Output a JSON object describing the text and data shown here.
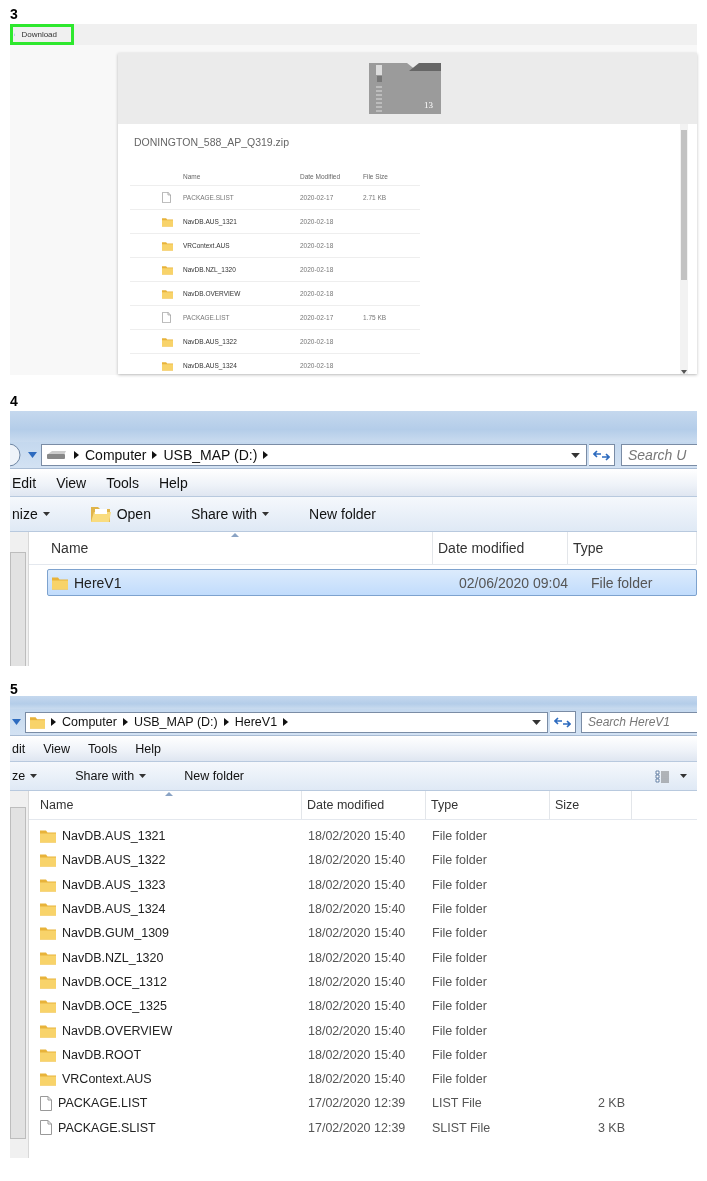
{
  "panels": [
    {
      "kind": "web",
      "number": "3",
      "download": {
        "label": "Download",
        "highlighted": true
      },
      "archive": {
        "name": "DONINGTON_588_AP_Q319.zip",
        "count": "13",
        "columns": [
          "Name",
          "Date Modified",
          "File Size"
        ],
        "rows": [
          {
            "kind": "file",
            "name": "PACKAGE.SLIST",
            "date": "2020-02-17",
            "size": "2.71 KB"
          },
          {
            "kind": "folder",
            "name": "NavDB.AUS_1321",
            "date": "2020-02-18"
          },
          {
            "kind": "folder",
            "name": "VRContext.AUS",
            "date": "2020-02-18"
          },
          {
            "kind": "folder",
            "name": "NavDB.NZL_1320",
            "date": "2020-02-18"
          },
          {
            "kind": "folder",
            "name": "NavDB.OVERVIEW",
            "date": "2020-02-18"
          },
          {
            "kind": "file",
            "name": "PACKAGE.LIST",
            "date": "2020-02-17",
            "size": "1.75 KB"
          },
          {
            "kind": "folder",
            "name": "NavDB.AUS_1322",
            "date": "2020-02-18"
          },
          {
            "kind": "folder",
            "name": "NavDB.AUS_1324",
            "date": "2020-02-18"
          }
        ]
      }
    },
    {
      "kind": "explorer",
      "number": "4",
      "back_button": true,
      "in_folder": false,
      "path": [
        "Computer",
        "USB_MAP (D:)"
      ],
      "search": {
        "placeholder": "Search U"
      },
      "menu": [
        "Edit",
        "View",
        "Tools",
        "Help"
      ],
      "toolbar": [
        {
          "kind": "text",
          "label": "nize",
          "dropdown": true
        },
        {
          "kind": "with_icon",
          "label": "Open",
          "dropdown": false
        },
        {
          "kind": "text",
          "label": "Share with",
          "dropdown": true
        },
        {
          "kind": "text",
          "label": "New folder",
          "dropdown": false
        }
      ],
      "view_button": false,
      "columns": [
        "Name",
        "Date modified",
        "Type"
      ],
      "rows": [
        {
          "kind": "folder",
          "name": "HereV1",
          "date": "02/06/2020 09:04",
          "type": "File folder",
          "selected": true
        }
      ]
    },
    {
      "kind": "explorer",
      "number": "5",
      "back_button": false,
      "in_folder": true,
      "path": [
        "Computer",
        "USB_MAP (D:)",
        "HereV1"
      ],
      "search": {
        "placeholder": "Search HereV1"
      },
      "menu": [
        "dit",
        "View",
        "Tools",
        "Help"
      ],
      "toolbar": [
        {
          "kind": "text",
          "label": "ze",
          "dropdown": true
        },
        {
          "kind": "text",
          "label": "Share with",
          "dropdown": true
        },
        {
          "kind": "text",
          "label": "New folder",
          "dropdown": false
        }
      ],
      "view_button": true,
      "columns": [
        "Name",
        "Date modified",
        "Type",
        "Size"
      ],
      "rows": [
        {
          "kind": "folder",
          "name": "NavDB.AUS_1321",
          "date": "18/02/2020 15:40",
          "type": "File folder",
          "selected": false
        },
        {
          "kind": "folder",
          "name": "NavDB.AUS_1322",
          "date": "18/02/2020 15:40",
          "type": "File folder",
          "selected": false
        },
        {
          "kind": "folder",
          "name": "NavDB.AUS_1323",
          "date": "18/02/2020 15:40",
          "type": "File folder",
          "selected": false
        },
        {
          "kind": "folder",
          "name": "NavDB.AUS_1324",
          "date": "18/02/2020 15:40",
          "type": "File folder",
          "selected": false
        },
        {
          "kind": "folder",
          "name": "NavDB.GUM_1309",
          "date": "18/02/2020 15:40",
          "type": "File folder",
          "selected": false
        },
        {
          "kind": "folder",
          "name": "NavDB.NZL_1320",
          "date": "18/02/2020 15:40",
          "type": "File folder",
          "selected": false
        },
        {
          "kind": "folder",
          "name": "NavDB.OCE_1312",
          "date": "18/02/2020 15:40",
          "type": "File folder",
          "selected": false
        },
        {
          "kind": "folder",
          "name": "NavDB.OCE_1325",
          "date": "18/02/2020 15:40",
          "type": "File folder",
          "selected": false
        },
        {
          "kind": "folder",
          "name": "NavDB.OVERVIEW",
          "date": "18/02/2020 15:40",
          "type": "File folder",
          "selected": false
        },
        {
          "kind": "folder",
          "name": "NavDB.ROOT",
          "date": "18/02/2020 15:40",
          "type": "File folder",
          "selected": false
        },
        {
          "kind": "folder",
          "name": "VRContext.AUS",
          "date": "18/02/2020 15:40",
          "type": "File folder",
          "selected": false
        },
        {
          "kind": "file",
          "name": "PACKAGE.LIST",
          "date": "17/02/2020 12:39",
          "type": "LIST File",
          "size": "2 KB",
          "selected": false
        },
        {
          "kind": "file",
          "name": "PACKAGE.SLIST",
          "date": "17/02/2020 12:39",
          "type": "SLIST File",
          "size": "3 KB",
          "selected": false
        }
      ]
    }
  ]
}
